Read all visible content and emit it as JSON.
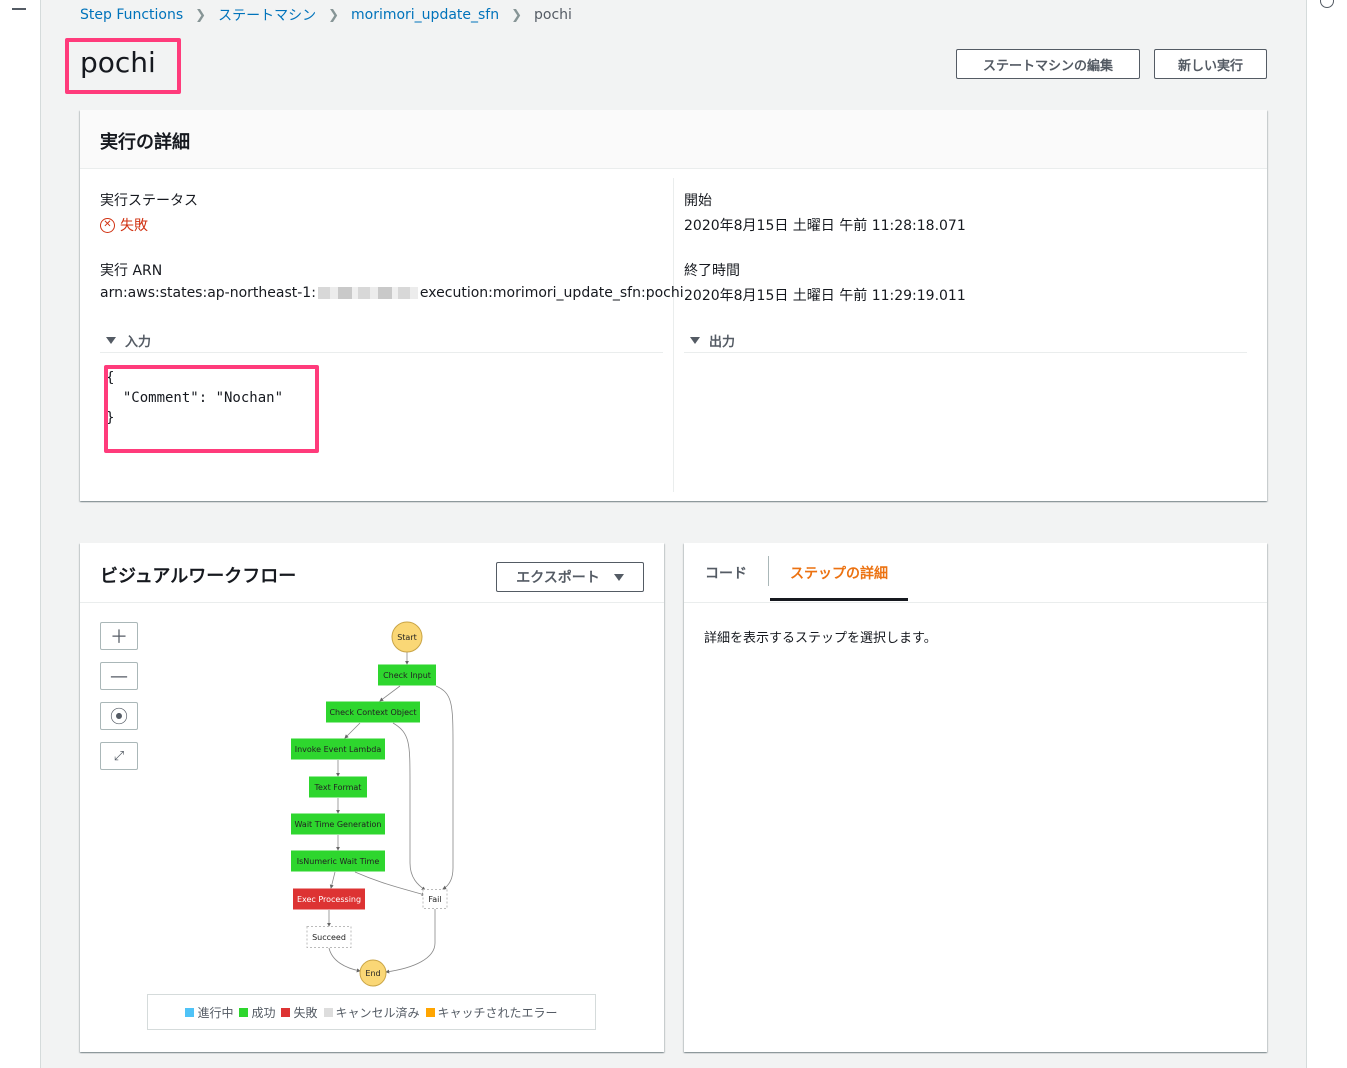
{
  "breadcrumb": {
    "items": [
      "Step Functions",
      "ステートマシン",
      "morimori_update_sfn"
    ],
    "current": "pochi"
  },
  "page": {
    "title": "pochi",
    "edit_button": "ステートマシンの編集",
    "new_execution_button": "新しい実行"
  },
  "details": {
    "title": "実行の詳細",
    "status_label": "実行ステータス",
    "status_value": "失敗",
    "arn_label": "実行 ARN",
    "arn_prefix": "arn:aws:states:ap-northeast-1:",
    "arn_suffix": "execution:morimori_update_sfn:pochi",
    "start_label": "開始",
    "start_value": "2020年8月15日 土曜日 午前 11:28:18.071",
    "end_label": "終了時間",
    "end_value": "2020年8月15日 土曜日 午前 11:29:19.011",
    "input_label": "入力",
    "output_label": "出力",
    "input_lines": [
      "{",
      "  \"Comment\": \"Nochan\"",
      "}"
    ]
  },
  "workflow": {
    "title": "ビジュアルワークフロー",
    "export_label": "エクスポート",
    "zoom_in_icon": "plus-icon",
    "zoom_out_icon": "minus-icon",
    "center_icon": "target-icon",
    "fullscreen_icon": "expand-icon",
    "colors": {
      "success": "#2ed62e",
      "failed": "#dd3333",
      "terminal": "#fad776",
      "neutral": "#ffffff",
      "in_progress": "#4fc3f7",
      "cancelled": "#dddddd",
      "caught_error": "#ffa500"
    },
    "nodes": [
      {
        "label": "Start",
        "status": "terminal"
      },
      {
        "label": "Check Input",
        "status": "success"
      },
      {
        "label": "Check Context Object",
        "status": "success"
      },
      {
        "label": "Invoke Event Lambda",
        "status": "success"
      },
      {
        "label": "Text Format",
        "status": "success"
      },
      {
        "label": "Wait Time Generation",
        "status": "success"
      },
      {
        "label": "IsNumeric Wait Time",
        "status": "success"
      },
      {
        "label": "Exec Processing",
        "status": "failed"
      },
      {
        "label": "Fail",
        "status": "neutral"
      },
      {
        "label": "Succeed",
        "status": "neutral"
      },
      {
        "label": "End",
        "status": "terminal"
      }
    ],
    "legend": [
      {
        "label": "進行中",
        "color": "#4fc3f7"
      },
      {
        "label": "成功",
        "color": "#2ed62e"
      },
      {
        "label": "失敗",
        "color": "#dd3333"
      },
      {
        "label": "キャンセル済み",
        "color": "#dddddd"
      },
      {
        "label": "キャッチされたエラー",
        "color": "#ffa500"
      }
    ]
  },
  "step_panel": {
    "tab_code": "コード",
    "tab_step": "ステップの詳細",
    "hint": "詳細を表示するステップを選択します。"
  }
}
